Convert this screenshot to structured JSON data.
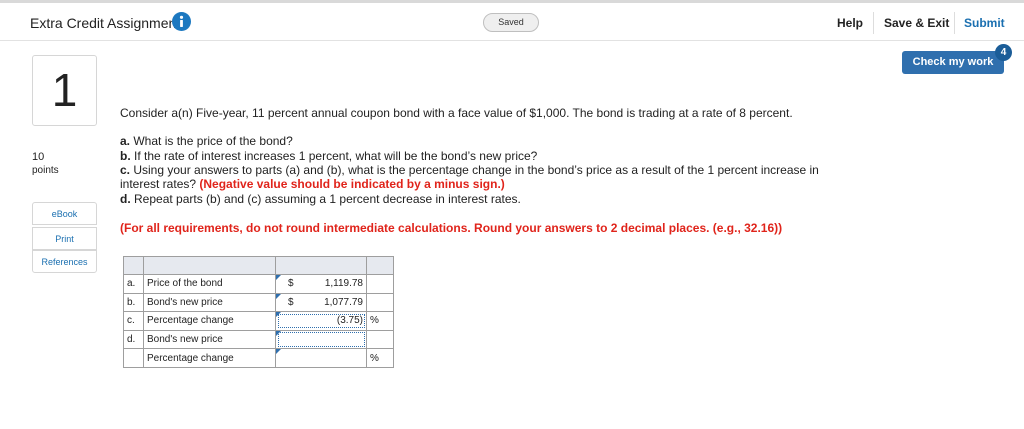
{
  "header": {
    "title": "Extra Credit Assignment",
    "saved_label": "Saved",
    "help_label": "Help",
    "save_exit_label": "Save & Exit",
    "submit_label": "Submit"
  },
  "check_work": {
    "label": "Check my work",
    "badge": "4"
  },
  "question": {
    "number": "1",
    "points_value": "10",
    "points_label": "points",
    "intro": "Consider a(n) Five-year, 11 percent annual coupon bond with a face value of $1,000. The bond is trading at a rate of 8 percent.",
    "a_prefix": "a.",
    "a_text": " What is the price of the bond?",
    "b_prefix": "b.",
    "b_text": " If the rate of interest increases 1 percent, what will be the bond’s new price?",
    "c_prefix": "c.",
    "c_text": " Using your answers to parts (a) and (b), what is the percentage change in the bond’s price as a result of the 1 percent increase in",
    "c_text2": "interest rates? ",
    "c_red": "(Negative value should be indicated by a minus sign.)",
    "d_prefix": "d.",
    "d_text": " Repeat parts (b) and (c) assuming a 1 percent decrease in interest rates.",
    "instruction": "(For all requirements, do not round intermediate calculations. Round your answers to 2 decimal places. (e.g., 32.16))"
  },
  "sidebar": {
    "ebook": "eBook",
    "print": "Print",
    "references": "References"
  },
  "answers": {
    "rows": [
      {
        "letter": "a.",
        "label": "Price of the bond",
        "dollar": "$",
        "value": "1,119.78",
        "unit": ""
      },
      {
        "letter": "b.",
        "label": "Bond's new price",
        "dollar": "$",
        "value": "1,077.79",
        "unit": ""
      },
      {
        "letter": "c.",
        "label": "Percentage change",
        "dollar": "",
        "value": "(3.75)",
        "unit": "%"
      },
      {
        "letter": "d.",
        "label": "Bond's new price",
        "dollar": "",
        "value": "",
        "unit": ""
      },
      {
        "letter": "",
        "label": "Percentage change",
        "dollar": "",
        "value": "",
        "unit": "%"
      }
    ]
  },
  "colors": {
    "accent_blue": "#2f6fae",
    "link_blue": "#1a6fb0",
    "instruction_red": "#e0241b"
  }
}
